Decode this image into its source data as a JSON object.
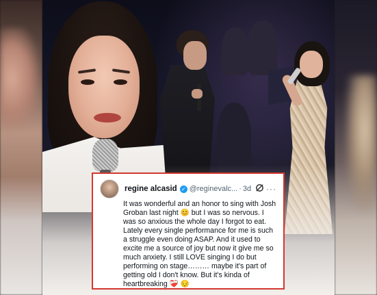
{
  "tweet": {
    "display_name": "regine alcasid",
    "handle": "@reginevalc...",
    "separator": "·",
    "time": "3d",
    "more": "···",
    "text": "It was wonderful and an honor to sing with Josh Groban  last night 😊 but I was so nervous. I was so anxious the whole day I forgot to eat. Lately every single performance for me is such a struggle even doing ASAP. And it used to excite me a source of joy but now it give me so much anxiety. I still LOVE singing I do but performing on stage……… maybe it's part of getting old I don't know. But it's kinda of heartbreaking ❤️‍🩹 😔",
    "verified_icon": "verified-badge-icon",
    "grok_icon": "grok-icon"
  },
  "colors": {
    "card_border": "#d2372e",
    "verified": "#1d9bf0"
  }
}
